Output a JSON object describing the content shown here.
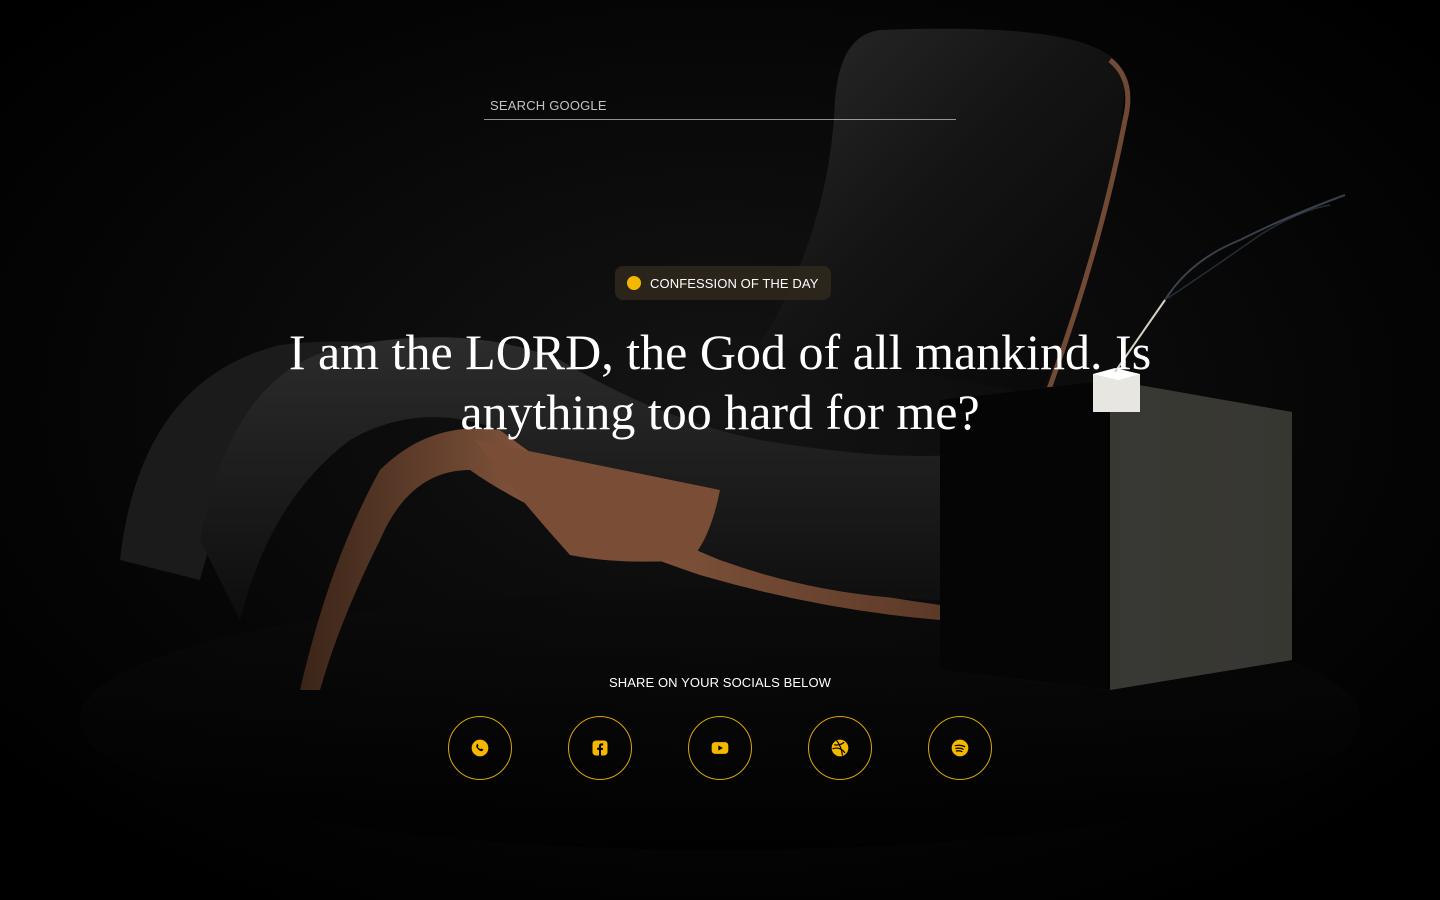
{
  "search": {
    "placeholder": "SEARCH GOOGLE"
  },
  "badge": {
    "label": "CONFESSION OF THE DAY",
    "dot_color": "#f5b800"
  },
  "quote": {
    "text": "I am the LORD, the God of all mankind. Is anything too hard for me?"
  },
  "share": {
    "label": "SHARE ON YOUR SOCIALS BELOW"
  },
  "socials": [
    {
      "icon": "whatsapp-icon"
    },
    {
      "icon": "facebook-icon"
    },
    {
      "icon": "youtube-icon"
    },
    {
      "icon": "dribbble-icon"
    },
    {
      "icon": "spotify-icon"
    }
  ],
  "colors": {
    "accent": "#d6a40a",
    "background": "#000000",
    "text": "#ffffff"
  }
}
